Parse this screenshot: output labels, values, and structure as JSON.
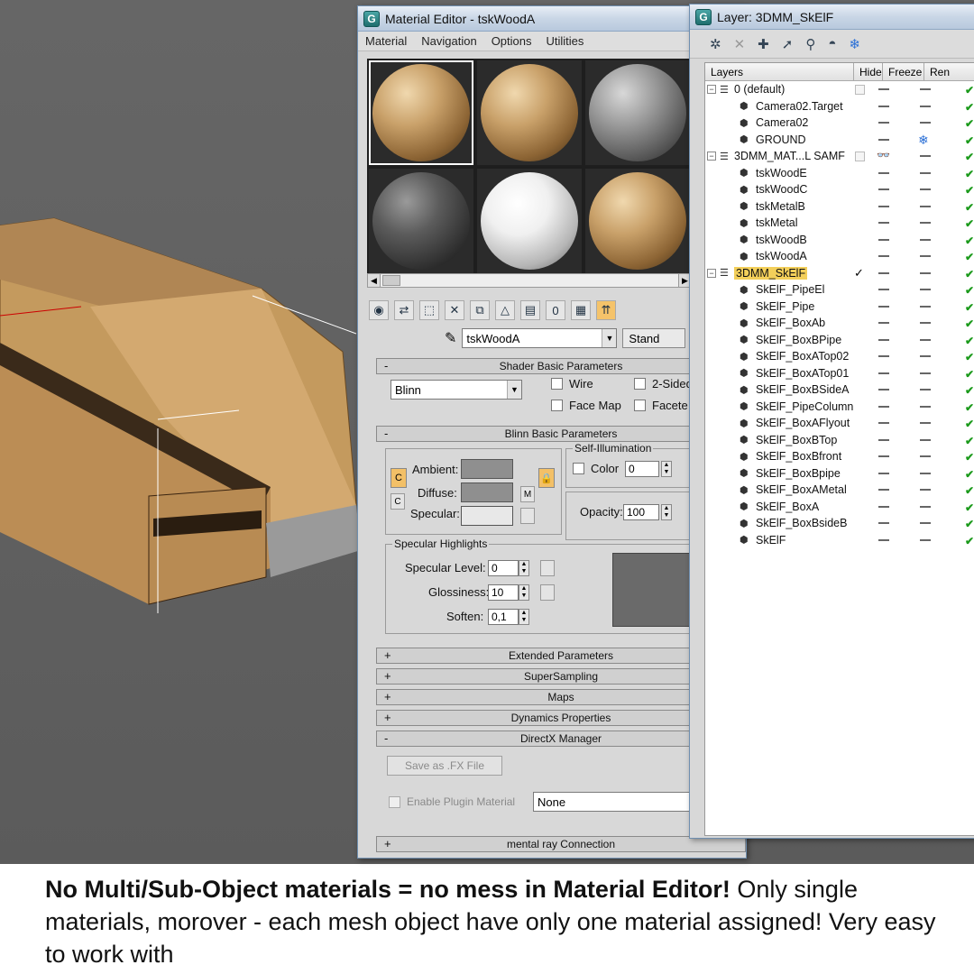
{
  "material_editor": {
    "title": "Material Editor - tskWoodA",
    "menu": [
      "Material",
      "Navigation",
      "Options",
      "Utilities"
    ],
    "current_material": "tskWoodA",
    "type_button": "Stand",
    "shader_rollout": "Shader Basic Parameters",
    "shader_type": "Blinn",
    "wire_label": "Wire",
    "two_sided_label": "2-Sided",
    "face_map_label": "Face Map",
    "faceted_label": "Facete",
    "blinn_rollout": "Blinn Basic Parameters",
    "ambient_label": "Ambient:",
    "diffuse_label": "Diffuse:",
    "specular_label": "Specular:",
    "map_btn": "M",
    "self_illum_group": "Self-Illumination",
    "color_label": "Color",
    "color_value": "0",
    "opacity_label": "Opacity:",
    "opacity_value": "100",
    "spec_highlights_group": "Specular Highlights",
    "spec_level_label": "Specular Level:",
    "spec_level_value": "0",
    "glossiness_label": "Glossiness:",
    "glossiness_value": "10",
    "soften_label": "Soften:",
    "soften_value": "0,1",
    "rollouts": [
      "Extended Parameters",
      "SuperSampling",
      "Maps",
      "Dynamics Properties"
    ],
    "directx_rollout": "DirectX Manager",
    "save_fx_btn": "Save as .FX File",
    "enable_plugin_label": "Enable Plugin Material",
    "plugin_value": "None",
    "mental_ray_rollout": "mental ray Connection",
    "pm_minus": "-",
    "pm_plus": "+"
  },
  "layer_window": {
    "title": "Layer: 3DMM_SkElF",
    "columns": [
      "Layers",
      "Hide",
      "Freeze",
      "Ren"
    ],
    "tree_minus": "−",
    "rows": [
      {
        "name": "0 (default)",
        "level": 0,
        "kind": "layer"
      },
      {
        "name": "Camera02.Target",
        "level": 1,
        "kind": "object"
      },
      {
        "name": "Camera02",
        "level": 1,
        "kind": "object"
      },
      {
        "name": "GROUND",
        "level": 1,
        "kind": "object",
        "frozen": true
      },
      {
        "name": "3DMM_MAT...L SAMF",
        "level": 0,
        "kind": "layer",
        "hidden": true
      },
      {
        "name": "tskWoodE",
        "level": 1,
        "kind": "object"
      },
      {
        "name": "tskWoodC",
        "level": 1,
        "kind": "object"
      },
      {
        "name": "tskMetalB",
        "level": 1,
        "kind": "object"
      },
      {
        "name": "tskMetal",
        "level": 1,
        "kind": "object"
      },
      {
        "name": "tskWoodB",
        "level": 1,
        "kind": "object"
      },
      {
        "name": "tskWoodA",
        "level": 1,
        "kind": "object"
      },
      {
        "name": "3DMM_SkElF",
        "level": 0,
        "kind": "layer",
        "current": true
      },
      {
        "name": "SkElF_PipeEl",
        "level": 1,
        "kind": "object"
      },
      {
        "name": "SkElF_Pipe",
        "level": 1,
        "kind": "object"
      },
      {
        "name": "SkElF_BoxAb",
        "level": 1,
        "kind": "object"
      },
      {
        "name": "SkElF_BoxBPipe",
        "level": 1,
        "kind": "object"
      },
      {
        "name": "SkElF_BoxATop02",
        "level": 1,
        "kind": "object"
      },
      {
        "name": "SkElF_BoxATop01",
        "level": 1,
        "kind": "object"
      },
      {
        "name": "SkElF_BoxBSideA",
        "level": 1,
        "kind": "object"
      },
      {
        "name": "SkElF_PipeColumn",
        "level": 1,
        "kind": "object"
      },
      {
        "name": "SkElF_BoxAFlyout",
        "level": 1,
        "kind": "object"
      },
      {
        "name": "SkElF_BoxBTop",
        "level": 1,
        "kind": "object"
      },
      {
        "name": "SkElF_BoxBfront",
        "level": 1,
        "kind": "object"
      },
      {
        "name": "SkElF_BoxBpipe",
        "level": 1,
        "kind": "object"
      },
      {
        "name": "SkElF_BoxAMetal",
        "level": 1,
        "kind": "object"
      },
      {
        "name": "SkElF_BoxA",
        "level": 1,
        "kind": "object"
      },
      {
        "name": "SkElF_BoxBsideB",
        "level": 1,
        "kind": "object"
      },
      {
        "name": "SkElF",
        "level": 1,
        "kind": "object"
      }
    ]
  },
  "caption": {
    "bold": "No Multi/Sub-Object materials = no mess in Material Editor!",
    "rest": " Only single materials, morover - each mesh object have only one material assigned! Very easy to work with"
  },
  "colors": {
    "accent": "#f3c067",
    "viewport": "#5f5f5f",
    "render_check": "#1c9a1c"
  }
}
